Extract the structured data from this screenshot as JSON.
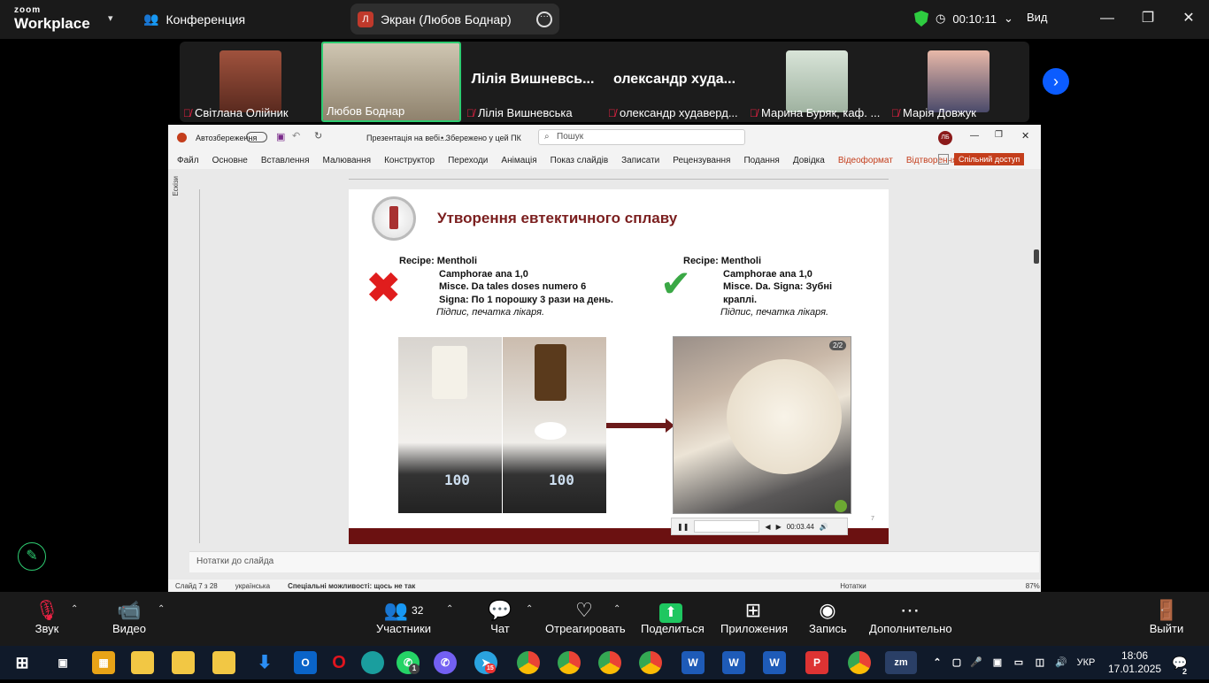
{
  "zoom": {
    "logo_small": "zoom",
    "logo_big": "Workplace",
    "conference_label": "Конференция",
    "share_title": "Экран (Любов Боднар)",
    "share_avatar": "Л",
    "timer": "00:10:11",
    "view_label": "Вид",
    "accent_color": "#0b5cff"
  },
  "participants": [
    {
      "name": "Світлана Олійник",
      "video": true
    },
    {
      "name": "Любов Боднар",
      "video": true,
      "active": true
    },
    {
      "name": "Лілія Вишневська",
      "big": "Лілія Вишневсь..."
    },
    {
      "name": "олександр худаверд...",
      "big": "олександр худа..."
    },
    {
      "name": "Марина Буряк, каф. ...",
      "video": true
    },
    {
      "name": "Марія Довжук",
      "video": true
    }
  ],
  "ppt": {
    "autosave": "Автозбереження",
    "filename": "Презентація на вебі...",
    "saved": "• Збережено у цей ПК",
    "search_placeholder": "Пошук",
    "user_initials": "ЛБ",
    "menu": [
      "Файл",
      "Основне",
      "Вставлення",
      "Малювання",
      "Конструктор",
      "Переходи",
      "Анімація",
      "Показ слайдів",
      "Записати",
      "Рецензування",
      "Подання",
      "Довідка",
      "Відеоформат",
      "Відтворення"
    ],
    "share_btn": "Спільний доступ",
    "thumbs_label": "Ескізи",
    "notes_placeholder": "Нотатки до слайда",
    "status": {
      "slide": "Слайд 7 з 28",
      "lang": "українська",
      "access": "Спеціальні можливості: щось не так",
      "notes": "Нотатки",
      "zoom": "87%"
    }
  },
  "slide": {
    "title": "Утворення евтектичного сплаву",
    "left_rx": [
      "Recipe: Mentholi",
      "Camphorae ana 1,0",
      "Misce. Da tales doses numero 6",
      "Signa: По 1 порошку 3 рази на день."
    ],
    "left_sign": "Підпис, печатка лікаря.",
    "right_rx": [
      "Recipe: Mentholi",
      "Camphorae ana 1,0",
      "Misce. Da. Signa: Зубні",
      "краплі."
    ],
    "right_sign": "Підпис, печатка лікаря.",
    "video_counter": "2/2",
    "video_time": "00:03.44",
    "scale_reading_1": "100",
    "scale_reading_2": "100",
    "page_number": "7"
  },
  "toolbar": {
    "audio": "Звук",
    "video": "Видео",
    "participants": "Участники",
    "participants_count": "32",
    "chat": "Чат",
    "react": "Отреагировать",
    "share": "Поделиться",
    "apps": "Приложения",
    "record": "Запись",
    "more": "Дополнительно",
    "leave": "Выйти"
  },
  "taskbar": {
    "lang": "УКР",
    "time": "18:06",
    "date": "17.01.2025",
    "notifications": "2",
    "badge_1": "1",
    "badge_15": "15"
  }
}
